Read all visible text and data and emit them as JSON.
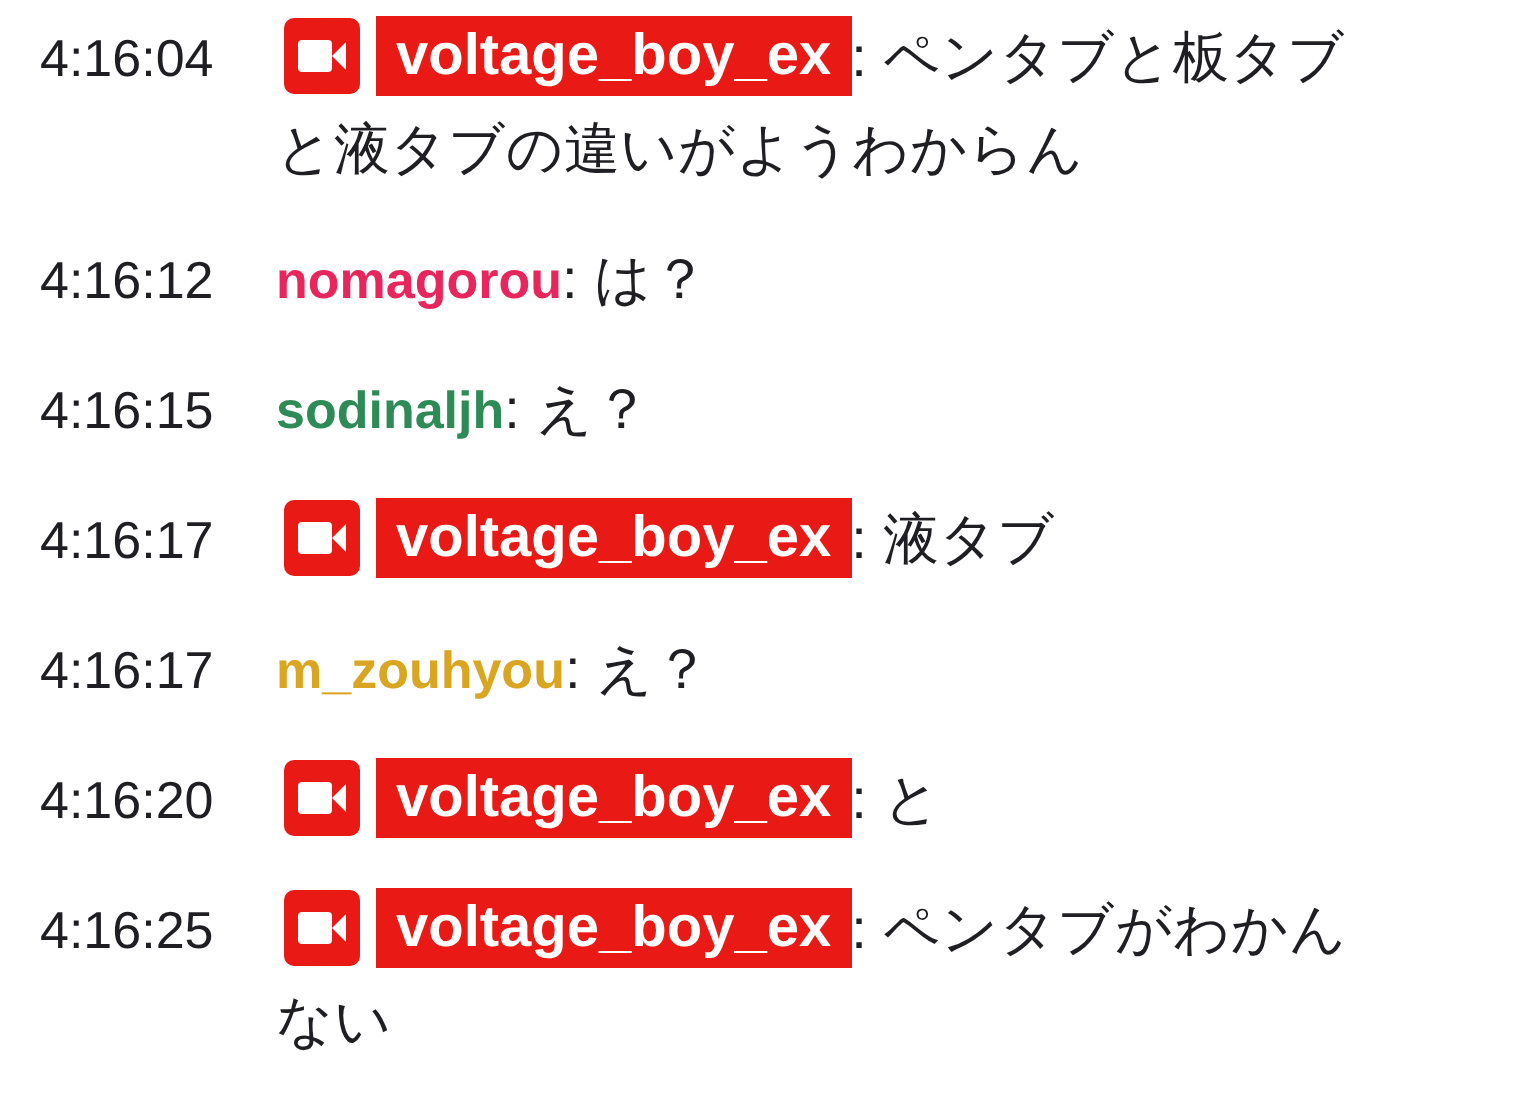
{
  "messages": [
    {
      "time": "4:16:04",
      "kind": "broadcaster",
      "user": "voltage_boy_ex",
      "color": "#e91916",
      "separator": ":",
      "lines": [
        "ペンタブと板タブ",
        "と液タブの違いがようわからん"
      ]
    },
    {
      "time": "4:16:12",
      "kind": "viewer",
      "user": "nomagorou",
      "color": "#e8265d",
      "separator": ":",
      "lines": [
        "は？"
      ]
    },
    {
      "time": "4:16:15",
      "kind": "viewer",
      "user": "sodinaljh",
      "color": "#2e8b57",
      "separator": ":",
      "lines": [
        "え？"
      ]
    },
    {
      "time": "4:16:17",
      "kind": "broadcaster",
      "user": "voltage_boy_ex",
      "color": "#e91916",
      "separator": ":",
      "lines": [
        "液タブ"
      ]
    },
    {
      "time": "4:16:17",
      "kind": "viewer",
      "user": "m_zouhyou",
      "color": "#daa520",
      "separator": ":",
      "lines": [
        "え？"
      ]
    },
    {
      "time": "4:16:20",
      "kind": "broadcaster",
      "user": "voltage_boy_ex",
      "color": "#e91916",
      "separator": ":",
      "lines": [
        "と"
      ]
    },
    {
      "time": "4:16:25",
      "kind": "broadcaster",
      "user": "voltage_boy_ex",
      "color": "#e91916",
      "separator": ":",
      "lines": [
        "ペンタブがわかん",
        "ない"
      ]
    }
  ]
}
